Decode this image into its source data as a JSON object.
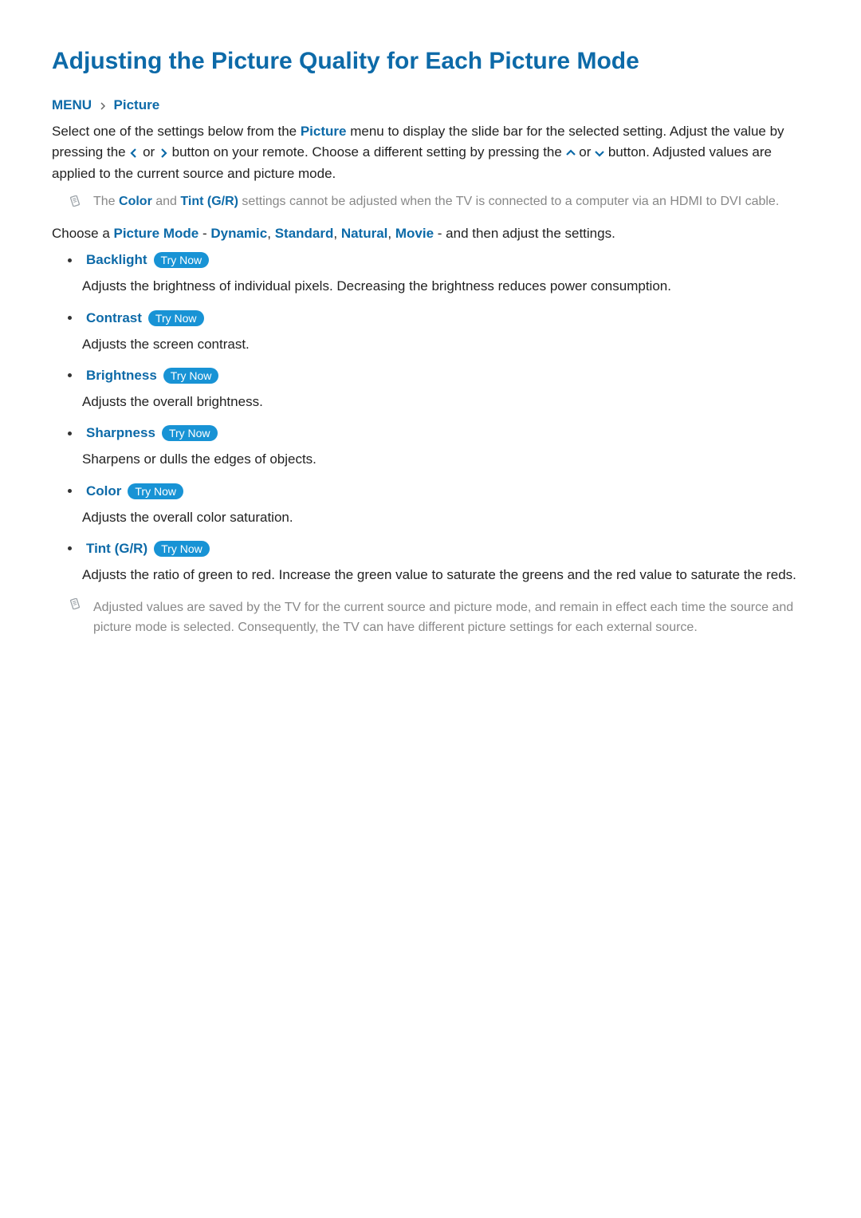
{
  "title": "Adjusting the Picture Quality for Each Picture Mode",
  "breadcrumb": {
    "menu": "MENU",
    "picture": "Picture"
  },
  "intro": {
    "part1": "Select one of the settings below from the ",
    "picture": "Picture",
    "part2": " menu to display the slide bar for the selected setting. Adjust the value by pressing the ",
    "or": " or ",
    "part3": " button on your remote. Choose a different setting by pressing the ",
    "part4": " button. Adjusted values are applied to the current source and picture mode."
  },
  "note1": {
    "prefix": "The ",
    "color": "Color",
    "and": " and ",
    "tint": "Tint (G/R)",
    "suffix": " settings cannot be adjusted when the TV is connected to a computer via an HDMI to DVI cable."
  },
  "choose": {
    "prefix": "Choose a ",
    "pm": "Picture Mode",
    "dash1": " - ",
    "dynamic": "Dynamic",
    "c1": ", ",
    "standard": "Standard",
    "c2": ", ",
    "natural": "Natural",
    "c3": ", ",
    "movie": "Movie",
    "dash2": " - and then adjust the settings."
  },
  "tryNowLabel": "Try Now",
  "settings": [
    {
      "name": "Backlight",
      "desc": "Adjusts the brightness of individual pixels. Decreasing the brightness reduces power consumption."
    },
    {
      "name": "Contrast",
      "desc": "Adjusts the screen contrast."
    },
    {
      "name": "Brightness",
      "desc": "Adjusts the overall brightness."
    },
    {
      "name": "Sharpness",
      "desc": "Sharpens or dulls the edges of objects."
    },
    {
      "name": "Color",
      "desc": "Adjusts the overall color saturation."
    },
    {
      "name": "Tint (G/R)",
      "desc": "Adjusts the ratio of green to red. Increase the green value to saturate the greens and the red value to saturate the reds."
    }
  ],
  "finalNote": "Adjusted values are saved by the TV for the current source and picture mode, and remain in effect each time the source and picture mode is selected. Consequently, the TV can have different picture settings for each external source."
}
